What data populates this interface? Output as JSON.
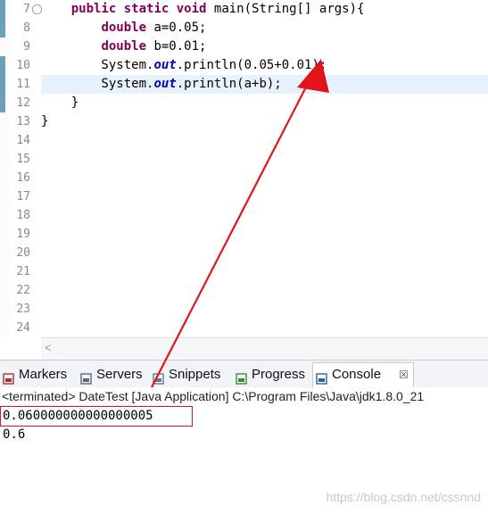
{
  "editor": {
    "lines": [
      {
        "num": "7",
        "fold": "⊖",
        "parts": [
          {
            "t": "    "
          },
          {
            "t": "public",
            "c": "kw"
          },
          {
            "t": " "
          },
          {
            "t": "static",
            "c": "kw"
          },
          {
            "t": " "
          },
          {
            "t": "void",
            "c": "kw"
          },
          {
            "t": " main(String[] args){"
          }
        ]
      },
      {
        "num": "8",
        "parts": [
          {
            "t": "        "
          },
          {
            "t": "double",
            "c": "kw"
          },
          {
            "t": " a=0.05;"
          }
        ]
      },
      {
        "num": "9",
        "parts": [
          {
            "t": "        "
          },
          {
            "t": "double",
            "c": "kw"
          },
          {
            "t": " b=0.01;"
          }
        ]
      },
      {
        "num": "10",
        "parts": [
          {
            "t": "        System."
          },
          {
            "t": "out",
            "c": "fld"
          },
          {
            "t": ".println(0.05+0.01);"
          }
        ]
      },
      {
        "num": "11",
        "current": true,
        "parts": [
          {
            "t": "        System."
          },
          {
            "t": "out",
            "c": "fld"
          },
          {
            "t": ".println(a+b);"
          }
        ]
      },
      {
        "num": "12",
        "parts": [
          {
            "t": "    }"
          }
        ]
      },
      {
        "num": "13",
        "parts": [
          {
            "t": "}"
          }
        ]
      },
      {
        "num": "14",
        "parts": []
      },
      {
        "num": "15",
        "parts": []
      },
      {
        "num": "16",
        "parts": []
      },
      {
        "num": "17",
        "parts": []
      },
      {
        "num": "18",
        "parts": []
      },
      {
        "num": "19",
        "parts": []
      },
      {
        "num": "20",
        "parts": []
      },
      {
        "num": "21",
        "parts": []
      },
      {
        "num": "22",
        "parts": []
      },
      {
        "num": "23",
        "parts": []
      },
      {
        "num": "24",
        "parts": []
      }
    ],
    "scroll_left_glyph": "<"
  },
  "panel": {
    "tabs": [
      {
        "name": "markers",
        "label": "Markers",
        "icon": "markers-icon",
        "color": "#b03030"
      },
      {
        "name": "servers",
        "label": "Servers",
        "icon": "servers-icon",
        "color": "#5b6b7d"
      },
      {
        "name": "snippets",
        "label": "Snippets",
        "icon": "snippets-icon",
        "color": "#6a7a8c"
      },
      {
        "name": "progress",
        "label": "Progress",
        "icon": "progress-icon",
        "color": "#3d8f3d"
      },
      {
        "name": "console",
        "label": "Console",
        "icon": "console-icon",
        "color": "#2f5f9f",
        "active": true,
        "close": "☒"
      }
    ]
  },
  "console": {
    "status": "<terminated> DateTest [Java Application] C:\\Program Files\\Java\\jdk1.8.0_21",
    "output": [
      "0.060000000000000005",
      "0.6"
    ],
    "watermark": "https://blog.csdn.net/cssnnd"
  },
  "colors": {
    "keyword": "#7f0055",
    "field": "#0000c0",
    "annotation": "#e0141a"
  }
}
